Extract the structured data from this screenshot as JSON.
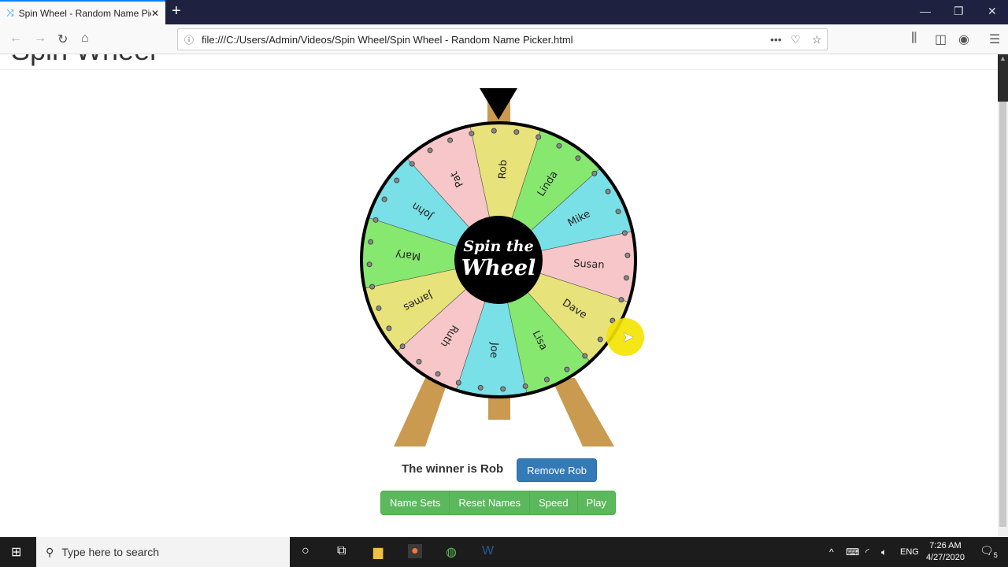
{
  "browser": {
    "tab_title": "Spin Wheel - Random Name Picker",
    "url": "file:///C:/Users/Admin/Videos/Spin Wheel/Spin Wheel - Random Name Picker.html"
  },
  "page": {
    "heading": "Spin Wheel",
    "wheel_center_line1": "Spin the",
    "wheel_center_line2": "Wheel",
    "segments": [
      {
        "name": "Rob",
        "color": "#e8e27a"
      },
      {
        "name": "Linda",
        "color": "#86e86e"
      },
      {
        "name": "Mike",
        "color": "#78e0e6"
      },
      {
        "name": "Susan",
        "color": "#f7c6c8"
      },
      {
        "name": "Dave",
        "color": "#e8e27a"
      },
      {
        "name": "Lisa",
        "color": "#86e86e"
      },
      {
        "name": "Joe",
        "color": "#78e0e6"
      },
      {
        "name": "Ruth",
        "color": "#f7c6c8"
      },
      {
        "name": "James",
        "color": "#e8e27a"
      },
      {
        "name": "Mary",
        "color": "#86e86e"
      },
      {
        "name": "John",
        "color": "#78e0e6"
      },
      {
        "name": "Pat",
        "color": "#f7c6c8"
      }
    ],
    "winner_text": "The winner is Rob",
    "remove_button": "Remove Rob",
    "buttons": [
      "Name Sets",
      "Reset Names",
      "Speed",
      "Play"
    ],
    "colors": {
      "stand": "#c99a50",
      "primary": "#337ab7",
      "success": "#5cb85c"
    }
  },
  "taskbar": {
    "search_placeholder": "Type here to search",
    "language": "ENG",
    "time": "7:26 AM",
    "date": "4/27/2020",
    "notifications": "5"
  }
}
